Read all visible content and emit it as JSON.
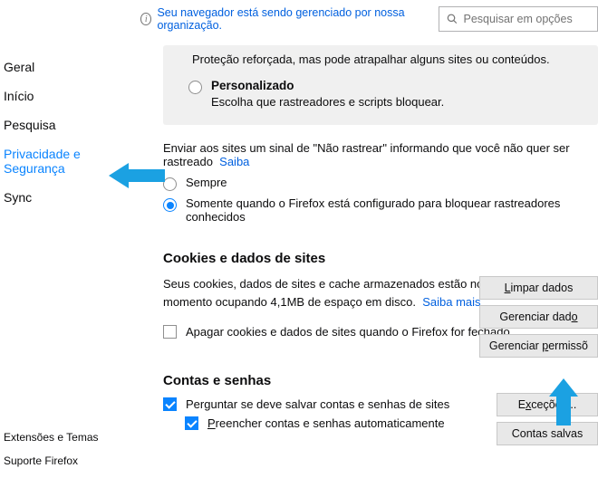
{
  "topbar": {
    "notice": "Seu navegador está sendo gerenciado por nossa organização.",
    "search_placeholder": "Pesquisar em opções"
  },
  "sidebar": {
    "items": [
      "Geral",
      "Início",
      "Pesquisa",
      "Privacidade e Segurança",
      "Sync"
    ],
    "active_index": 3,
    "bottom": [
      "Extensões e Temas",
      "Suporte Firefox"
    ]
  },
  "banner": {
    "prev_desc": "Proteção reforçada, mas pode atrapalhar alguns sites ou conteúdos.",
    "custom_title": "Personalizado",
    "custom_desc": "Escolha que rastreadores e scripts bloquear."
  },
  "dnt": {
    "text": "Enviar aos sites um sinal de \"Não rastrear\" informando que você não quer ser rastreado",
    "learn": "Saiba",
    "opt_always": "Sempre",
    "opt_known": "Somente quando o Firefox está configurado para bloquear rastreadores conhecidos"
  },
  "cookies": {
    "heading": "Cookies e dados de sites",
    "desc_a": "Seus cookies, dados de sites e cache armazenados estão no momento ocupando ",
    "size": "4,1MB",
    "desc_b": " de espaço em disco.",
    "learn": "Saiba mais",
    "clear_on_close": "Apagar cookies e dados de sites quando o Firefox for fechado",
    "btn_clear": "Limpar dados",
    "btn_manage": "Gerenciar dados",
    "btn_perms": "Gerenciar permissõ"
  },
  "logins": {
    "heading": "Contas e senhas",
    "ask_save": "Perguntar se deve salvar contas e senhas de sites",
    "autofill": "Preencher contas e senhas automaticamente",
    "btn_exceptions": "Exceções...",
    "btn_saved": "Contas salvas"
  }
}
